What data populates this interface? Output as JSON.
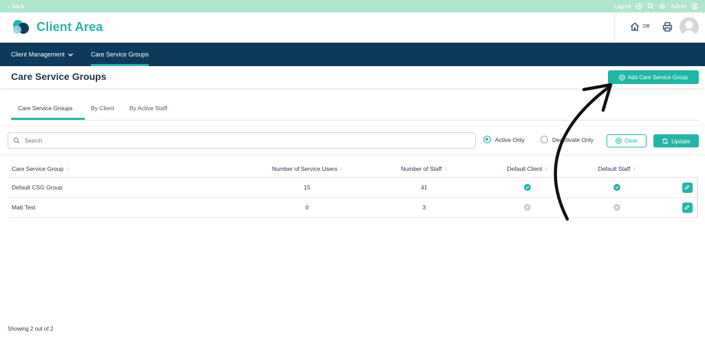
{
  "topbar": {
    "back_label": "Back",
    "logout_label": "Logout",
    "user_label": "Admin"
  },
  "header": {
    "app_title": "Client Area",
    "home_label": "DB"
  },
  "nav": {
    "items": [
      {
        "label": "Client Management",
        "has_dropdown": true
      },
      {
        "label": "Care Service Groups",
        "active": true
      }
    ]
  },
  "page": {
    "title": "Care Service Groups",
    "add_button_label": "Add Care Service Group"
  },
  "tabs": [
    {
      "label": "Care Service Groups",
      "active": true
    },
    {
      "label": "By Client"
    },
    {
      "label": "By Active Staff"
    }
  ],
  "filters": {
    "search_placeholder": "Search",
    "active_only_label": "Active Only",
    "deactivate_only_label": "Deactivate Only",
    "selected": "Active Only",
    "clear_label": "Clear",
    "update_label": "Update"
  },
  "table": {
    "columns": [
      "Care Service Group",
      "Number of Service Users",
      "Number of Staff",
      "Default Client",
      "Default Staff"
    ],
    "rows": [
      {
        "name": "Default CSG Group",
        "service_users": "15",
        "staff": "41",
        "default_client": true,
        "default_staff": true
      },
      {
        "name": "Matt Test",
        "service_users": "0",
        "staff": "3",
        "default_client": false,
        "default_staff": false
      }
    ]
  },
  "footer": {
    "showing_label": "Showing 2 out of 2"
  },
  "colors": {
    "accent": "#21b6a8",
    "nav_bg": "#0e3a5c",
    "topbar_bg": "#aee6cc"
  }
}
